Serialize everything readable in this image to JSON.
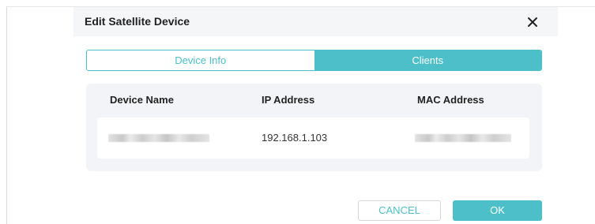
{
  "dialog": {
    "title": "Edit Satellite Device",
    "close_icon": "close-icon"
  },
  "tabs": [
    {
      "label": "Device Info",
      "active": false
    },
    {
      "label": "Clients",
      "active": true
    }
  ],
  "table": {
    "columns": [
      "Device Name",
      "IP Address",
      "MAC Address"
    ],
    "rows": [
      {
        "device_name": "",
        "ip_address": "192.168.1.103",
        "mac_address": ""
      }
    ]
  },
  "buttons": {
    "cancel_label": "CANCEL",
    "ok_label": "OK"
  },
  "colors": {
    "accent": "#4dbfc9",
    "header_bg": "#f5f6f8",
    "table_bg": "#f3f4f7"
  }
}
